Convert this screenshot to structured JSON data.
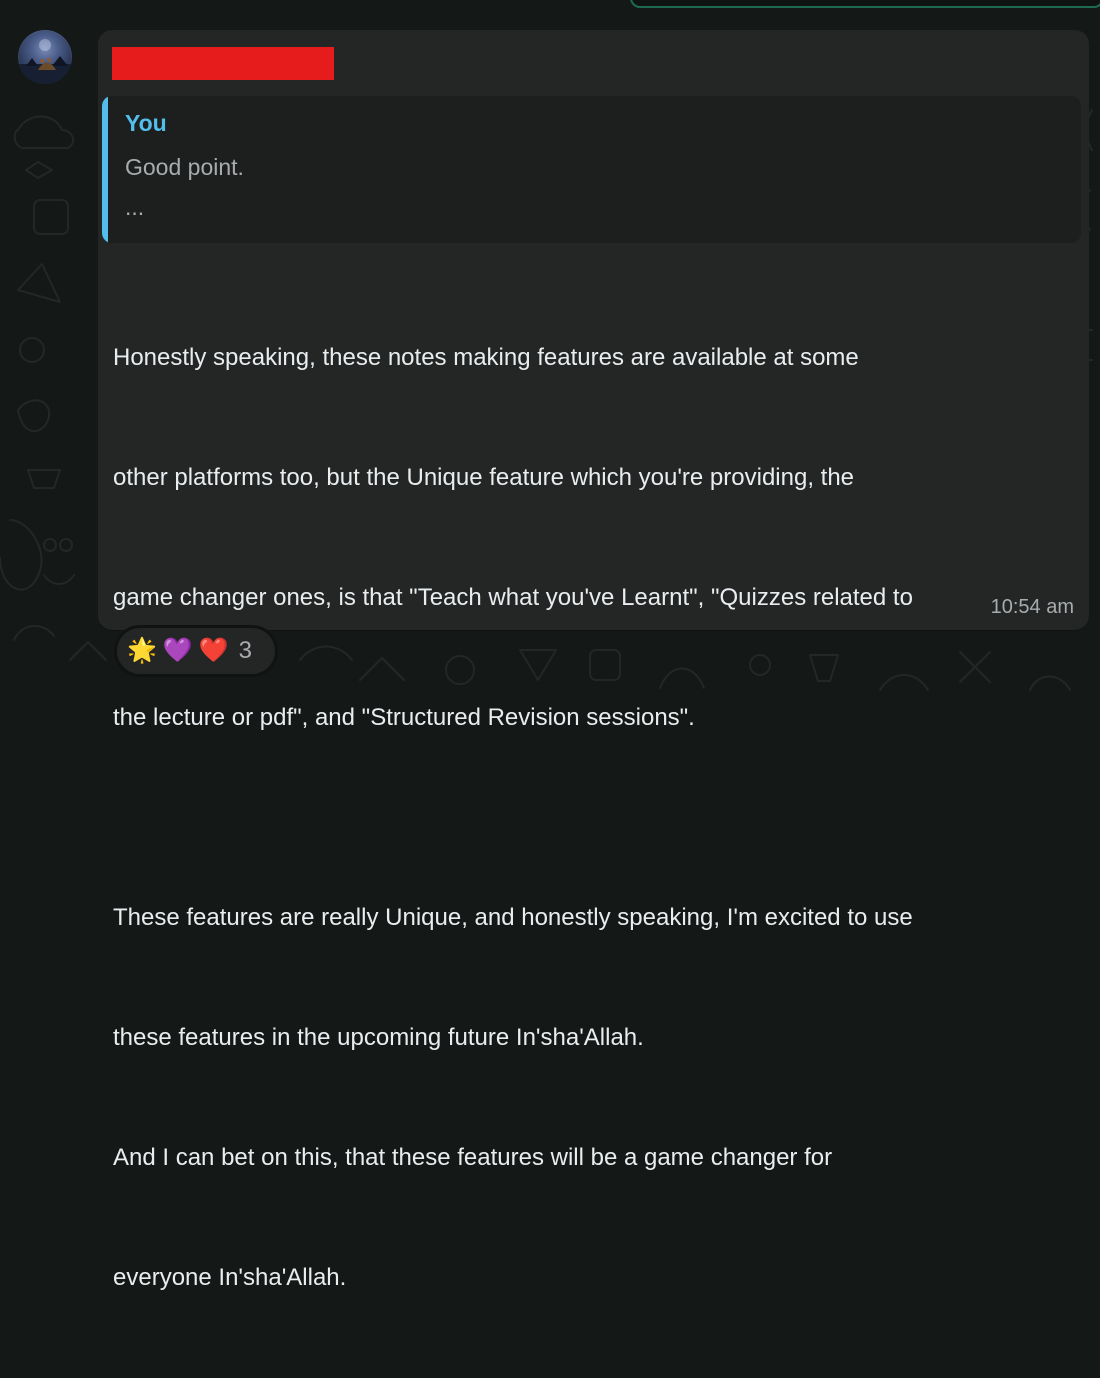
{
  "message": {
    "quote_author": "You",
    "quote_text": "Good point.",
    "quote_ellipsis": "...",
    "body_lines": [
      "Honestly speaking, these notes making features are available at some",
      "other platforms too, but the Unique feature which you're providing, the",
      "game changer ones, is that \"Teach what you've Learnt\", \"Quizzes related to",
      "the lecture or pdf\", and \"Structured Revision sessions\".",
      "",
      "These features are really Unique, and honestly speaking, I'm excited to use",
      "these features in the upcoming future In'sha'Allah.",
      "And I can bet on this, that these features will be a game changer for",
      "everyone In'sha'Allah."
    ],
    "timestamp": "10:54 am"
  },
  "reactions": {
    "emojis": [
      "🌟",
      "💜",
      "❤️"
    ],
    "count": "3"
  },
  "colors": {
    "wallpaper": "#141817",
    "bubble": "#242626",
    "quote_background": "#1d1f1f",
    "quote_accent": "#53bdeb",
    "sender_redaction": "#e61b1b",
    "text_primary": "#e9edef",
    "text_secondary": "#a8acae"
  }
}
